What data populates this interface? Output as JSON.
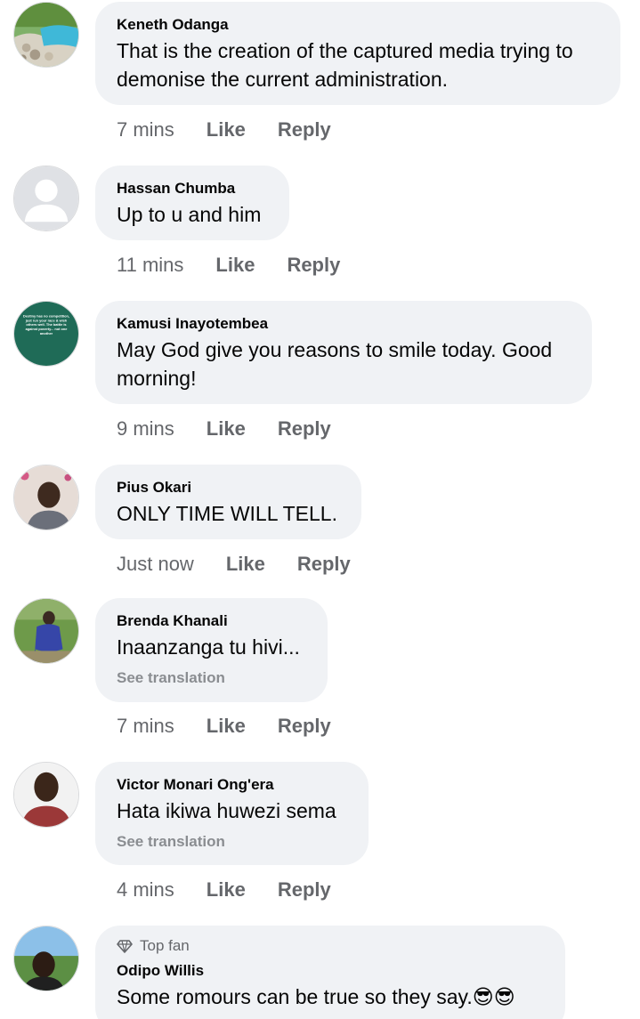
{
  "comments": [
    {
      "author": "Keneth Odanga",
      "text": "That is the creation of the captured media trying to demonise the current administration.",
      "time": "7 mins",
      "like": "Like",
      "reply": "Reply"
    },
    {
      "author": "Hassan Chumba",
      "text": "Up to u and him",
      "time": "11 mins",
      "like": "Like",
      "reply": "Reply"
    },
    {
      "author": "Kamusi Inayotembea",
      "text": "May God give you reasons to smile today. Good morning!",
      "time": "9 mins",
      "like": "Like",
      "reply": "Reply",
      "avatar_text": "Destiny has no competition, just run your race & wish others well. The battle is against poverty... not one another"
    },
    {
      "author": "Pius Okari",
      "text": "ONLY TIME WILL TELL.",
      "time": "Just now",
      "like": "Like",
      "reply": "Reply"
    },
    {
      "author": "Brenda Khanali",
      "text": "Inaanzanga tu hivi...",
      "see_translation": "See translation",
      "time": "7 mins",
      "like": "Like",
      "reply": "Reply"
    },
    {
      "author": "Victor Monari Ong'era",
      "text": "Hata ikiwa huwezi sema",
      "see_translation": "See translation",
      "time": "4 mins",
      "like": "Like",
      "reply": "Reply"
    },
    {
      "badge": "Top fan",
      "author": "Odipo Willis",
      "text": "Some romours can be true so they say.",
      "emoji": "😎😎"
    }
  ],
  "icons": {
    "avatar_0": "landscape-photo-avatar",
    "avatar_1": "default-profile-avatar",
    "avatar_2": "quote-image-avatar",
    "avatar_3": "profile-photo-avatar",
    "avatar_4": "profile-photo-avatar",
    "avatar_5": "profile-photo-avatar",
    "avatar_6": "profile-photo-avatar",
    "top_fan": "diamond-icon"
  },
  "colors": {
    "bubble": "#f0f2f5",
    "meta_text": "#65676b",
    "author_text": "#050505",
    "translation_text": "#8a8d91"
  }
}
